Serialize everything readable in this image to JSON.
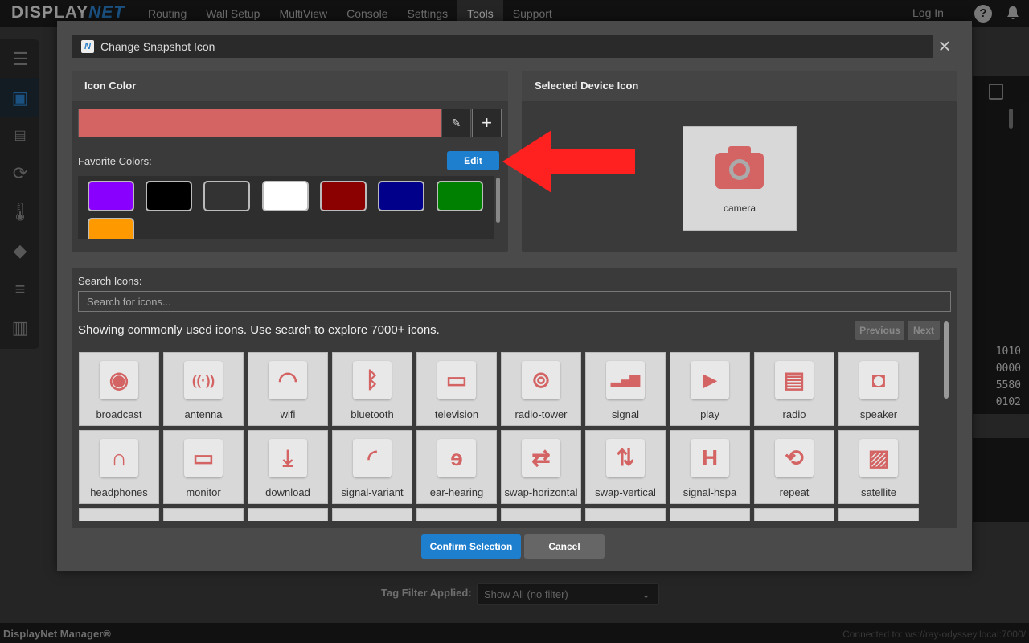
{
  "app": {
    "logo_main": "DISPLAY",
    "logo_accent": "NET",
    "nav": [
      "Routing",
      "Wall Setup",
      "MultiView",
      "Console",
      "Settings",
      "Tools",
      "Support"
    ],
    "active_nav": "Tools",
    "login": "Log In"
  },
  "background": {
    "code_lines": [
      "1010",
      "0000",
      "5580",
      "0102"
    ],
    "tag_filter_label": "Tag Filter Applied:",
    "tag_filter_value": "Show All (no filter)",
    "footer_title": "DisplayNet Manager®",
    "footer_connection": "Connected to: ws://ray-odyssey.local:7000/"
  },
  "modal": {
    "title": "Change Snapshot Icon",
    "icon_color": {
      "header": "Icon Color",
      "current_color": "#d46363",
      "favorite_label": "Favorite Colors:",
      "edit_label": "Edit",
      "favorites": [
        "#8a00ff",
        "#000000",
        "#333333",
        "#ffffff",
        "#8b0000",
        "#00008b",
        "#008000",
        "#ff9900"
      ]
    },
    "selected_device": {
      "header": "Selected Device Icon",
      "icon": "camera-icon",
      "label": "camera"
    },
    "search": {
      "label": "Search Icons:",
      "placeholder": "Search for icons...",
      "showing_text": "Showing commonly used icons. Use search to explore 7000+ icons.",
      "previous_label": "Previous",
      "next_label": "Next"
    },
    "icons": [
      {
        "label": "broadcast",
        "glyph": "◉"
      },
      {
        "label": "antenna",
        "glyph": "((·))"
      },
      {
        "label": "wifi",
        "glyph": "◠"
      },
      {
        "label": "bluetooth",
        "glyph": "ᛒ"
      },
      {
        "label": "television",
        "glyph": "▭"
      },
      {
        "label": "radio-tower",
        "glyph": "⊚"
      },
      {
        "label": "signal",
        "glyph": "▂▄▆"
      },
      {
        "label": "play",
        "glyph": "▶"
      },
      {
        "label": "radio",
        "glyph": "▤"
      },
      {
        "label": "speaker",
        "glyph": "◘"
      },
      {
        "label": "headphones",
        "glyph": "∩"
      },
      {
        "label": "monitor",
        "glyph": "▭"
      },
      {
        "label": "download",
        "glyph": "⤓"
      },
      {
        "label": "signal-variant",
        "glyph": "◜"
      },
      {
        "label": "ear-hearing",
        "glyph": "ɘ"
      },
      {
        "label": "swap-horizontal",
        "glyph": "⇄"
      },
      {
        "label": "swap-vertical",
        "glyph": "⇅"
      },
      {
        "label": "signal-hspa",
        "glyph": "H"
      },
      {
        "label": "repeat",
        "glyph": "⟲"
      },
      {
        "label": "satellite",
        "glyph": "▨"
      }
    ],
    "confirm_label": "Confirm Selection",
    "cancel_label": "Cancel"
  }
}
